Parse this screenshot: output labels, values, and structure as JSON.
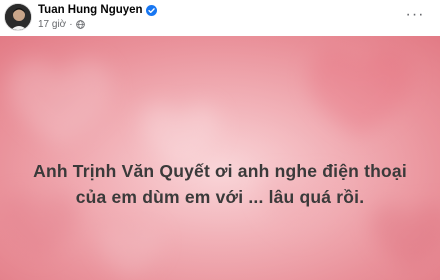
{
  "post": {
    "author_name": "Tuan Hung Nguyen",
    "verified": true,
    "timestamp": "17 giờ",
    "separator": "·",
    "privacy_icon": "globe-icon",
    "more_label": "···",
    "text_lines": [
      "Anh Trịnh Văn Quyết ơi anh nghe điện thoại",
      "của em dùm em với ... lâu quá rồi."
    ]
  },
  "colors": {
    "verified_badge": "#1877f2",
    "text_primary": "#050505",
    "text_secondary": "#65676b",
    "background_pink": "#ec8f98",
    "post_text": "#3a3a3a"
  }
}
